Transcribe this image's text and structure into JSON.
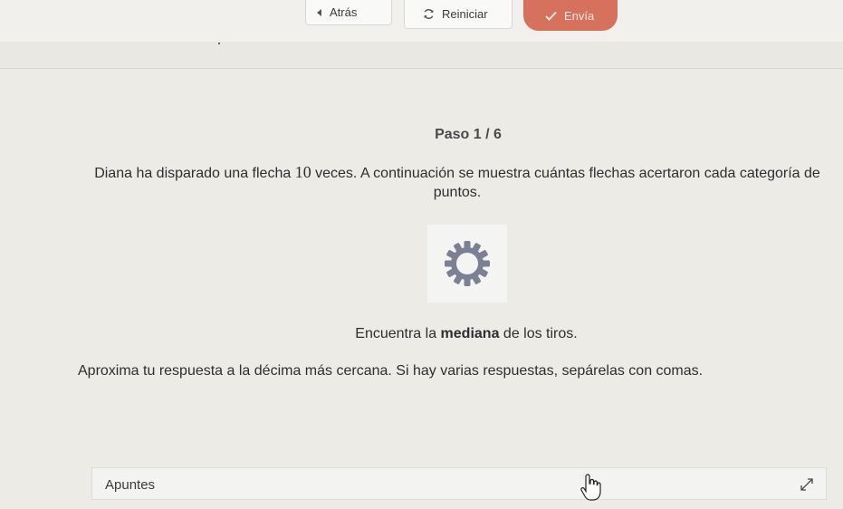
{
  "toolbar": {
    "back_label": "Atrás",
    "reset_label": "Reiniciar",
    "submit_label": "Envía",
    "back_icon": "chevron-left-icon",
    "reset_icon": "refresh-icon",
    "submit_icon": "check-icon"
  },
  "main": {
    "step": "Paso 1 / 6",
    "problem_before": "Diana ha disparado una flecha ",
    "problem_number": "10",
    "problem_after": " veces. A continuación se muestra cuántas flechas acertaron cada categoría de puntos.",
    "loading_icon": "gear-loading-icon",
    "instruction_before": "Encuentra la ",
    "instruction_bold": "mediana",
    "instruction_after": " de los tiros.",
    "approx_text": "Aproxima tu respuesta a la décima más cercana. Si hay varias respuestas, sepárelas con comas."
  },
  "notes": {
    "label": "Apuntes",
    "expand_icon": "expand-icon"
  },
  "colors": {
    "submit_bg": "#d6715d",
    "page_bg": "#ecebe6"
  }
}
